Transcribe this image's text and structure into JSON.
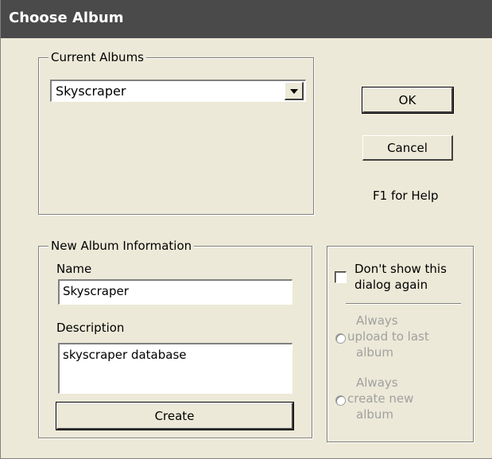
{
  "window": {
    "title": "Choose Album"
  },
  "current_albums": {
    "legend": "Current Albums",
    "selected": "Skyscraper"
  },
  "buttons": {
    "ok": "OK",
    "cancel": "Cancel",
    "create": "Create"
  },
  "help_text": "F1 for Help",
  "new_album": {
    "legend": "New Album Information",
    "name_label": "Name",
    "name_value": "Skyscraper",
    "description_label": "Description",
    "description_value": "skyscraper database"
  },
  "options": {
    "dont_show_line1": "Don't show  this",
    "dont_show_line2": "dialog again",
    "dont_show_checked": false,
    "upload_last_line1": "Always",
    "upload_last_line2": "upload to last",
    "upload_last_line3": "album",
    "create_new_line1": "Always",
    "create_new_line2": "create new",
    "create_new_line3": "album"
  },
  "icons": {
    "dropdown": "chevron-down-icon"
  }
}
